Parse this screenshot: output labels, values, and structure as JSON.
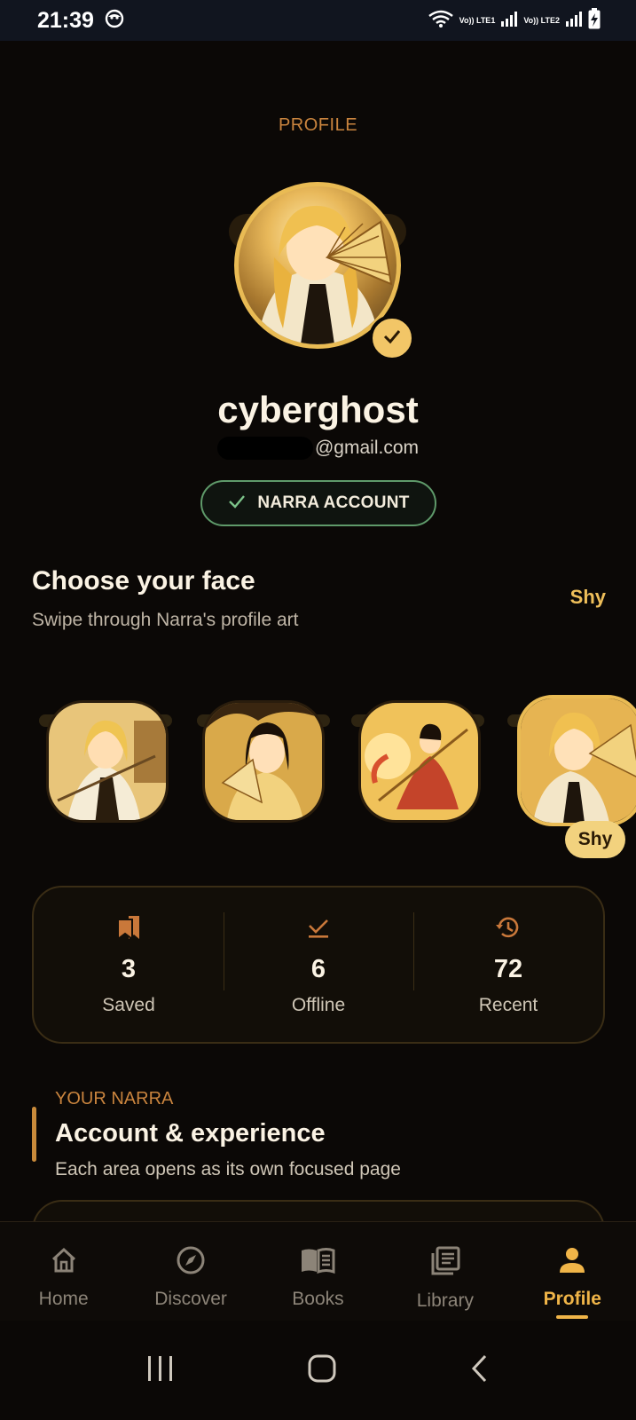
{
  "status_bar": {
    "time": "21:39",
    "net1": "Vo)) LTE1",
    "net2": "Vo)) LTE2"
  },
  "header": {
    "title": "PROFILE"
  },
  "profile": {
    "username": "cyberghost",
    "email_suffix": "@gmail.com",
    "account_badge": "NARRA ACCOUNT"
  },
  "faces": {
    "title": "Choose your face",
    "subtitle": "Swipe through Narra's profile art",
    "current": "Shy",
    "selected_chip": "Shy",
    "accent": "#e9bb54"
  },
  "stats": [
    {
      "icon": "bookmarks-icon",
      "value": "3",
      "label": "Saved"
    },
    {
      "icon": "download-check-icon",
      "value": "6",
      "label": "Offline"
    },
    {
      "icon": "history-icon",
      "value": "72",
      "label": "Recent"
    }
  ],
  "section": {
    "kicker": "YOUR NARRA",
    "title": "Account & experience",
    "subtitle": "Each area opens as its own focused page"
  },
  "nav": {
    "items": [
      {
        "label": "Home",
        "icon": "home-icon"
      },
      {
        "label": "Discover",
        "icon": "compass-icon"
      },
      {
        "label": "Books",
        "icon": "open-book-icon"
      },
      {
        "label": "Library",
        "icon": "library-icon"
      },
      {
        "label": "Profile",
        "icon": "person-icon"
      }
    ],
    "active": "Profile",
    "active_color": "#f0b548"
  }
}
